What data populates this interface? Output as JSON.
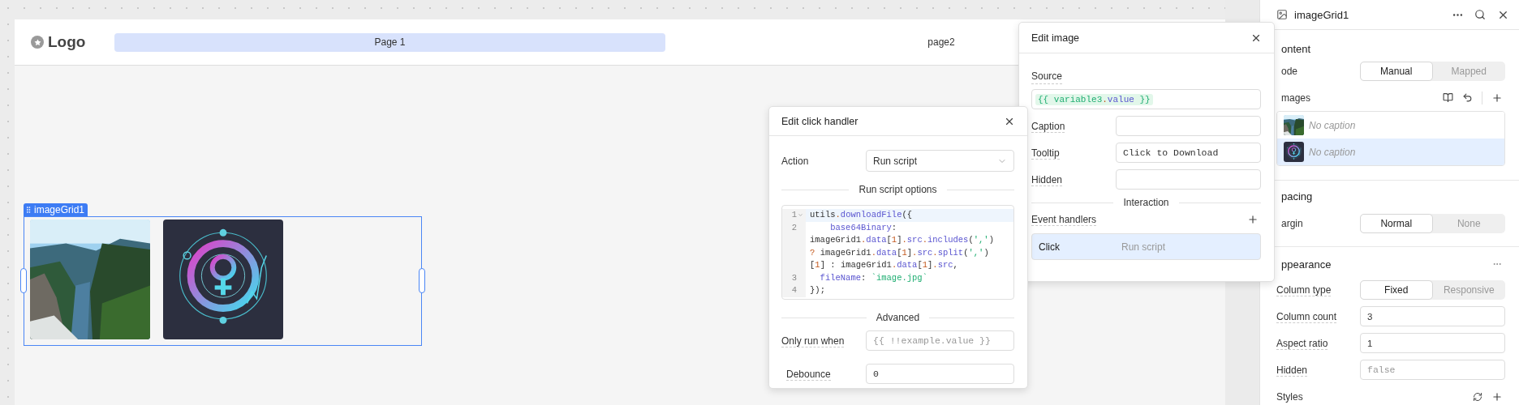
{
  "app_header": {
    "logo": "Logo",
    "nav": [
      {
        "label": "Page 1",
        "selected": true
      },
      {
        "label": "page2",
        "selected": false
      }
    ]
  },
  "canvas": {
    "component_label": "imageGrid1"
  },
  "click_handler_dialog": {
    "title": "Edit click handler",
    "action": {
      "label": "Action",
      "value": "Run script"
    },
    "script_section": "Run script options",
    "code": [
      {
        "number": "1",
        "active": true,
        "foldable": true,
        "lines": [
          "utils.downloadFile({"
        ]
      },
      {
        "number": "2",
        "active": false,
        "foldable": false,
        "lines": [
          "    base64Binary:",
          "imageGrid1.data[1].src.includes(',')",
          "? imageGrid1.data[1].src.split(',')",
          "[1] : imageGrid1.data[1].src,"
        ]
      },
      {
        "number": "3",
        "active": false,
        "foldable": false,
        "lines": [
          "  fileName: `image.jpg`"
        ]
      },
      {
        "number": "4",
        "active": false,
        "foldable": false,
        "lines": [
          "});"
        ]
      }
    ],
    "advanced_section": "Advanced",
    "only_run_when": {
      "label": "Only run when",
      "placeholder": "{{ !!example.value }}"
    },
    "debounce": {
      "label": "Debounce",
      "value": "0"
    }
  },
  "edit_image_dialog": {
    "title": "Edit image",
    "source": {
      "label": "Source",
      "value": "{{ variable3.value }}"
    },
    "fields": [
      {
        "label": "Caption"
      },
      {
        "label": "Tooltip",
        "value": "Click to Download"
      },
      {
        "label": "Hidden"
      }
    ],
    "interaction_section": "Interaction",
    "event_handlers": {
      "label": "Event handlers",
      "items": [
        {
          "event": "Click",
          "action": "Run script",
          "selected": true
        }
      ]
    }
  },
  "inspector": {
    "title": "imageGrid1",
    "content": {
      "heading": "ontent",
      "mode": {
        "label": "ode",
        "options": [
          {
            "label": "Manual",
            "selected": true
          },
          {
            "label": "Mapped",
            "selected": false
          }
        ]
      },
      "images_label": "mages",
      "images": [
        {
          "caption": "No caption",
          "selected": false
        },
        {
          "caption": "No caption",
          "selected": true
        }
      ]
    },
    "spacing": {
      "heading": "pacing",
      "margin": {
        "label": "argin",
        "options": [
          {
            "label": "Normal",
            "selected": true
          },
          {
            "label": "None",
            "selected": false
          }
        ]
      }
    },
    "appearance": {
      "heading": "ppearance",
      "column_type": {
        "label": "Column type",
        "options": [
          {
            "label": "Fixed",
            "selected": true
          },
          {
            "label": "Responsive",
            "selected": false
          }
        ]
      },
      "fields": [
        {
          "label": "Column count",
          "value": "3"
        },
        {
          "label": "Aspect ratio",
          "value": "1"
        },
        {
          "label": "Hidden",
          "placeholder": "false"
        }
      ],
      "styles_label": "Styles"
    }
  }
}
